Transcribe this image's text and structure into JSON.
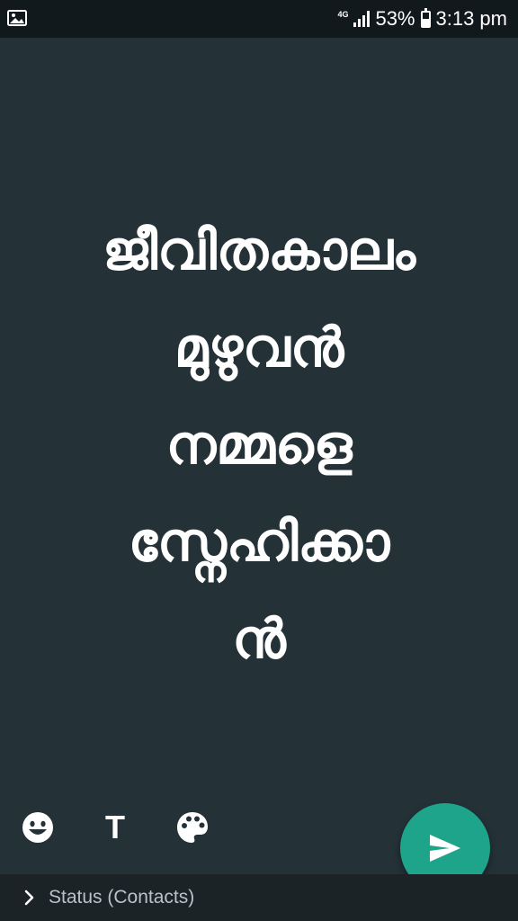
{
  "status_bar": {
    "network": "4G",
    "battery_percent": "53%",
    "battery_level": 0.53,
    "time": "3:13 pm",
    "notification_icon": "image-icon"
  },
  "message": {
    "lines": [
      "ജീവിതകാലം",
      "മുഴുവൻ",
      "നമ്മളെ",
      "സ്നേഹിക്കാ",
      "ൻ"
    ]
  },
  "toolbar": {
    "emoji_icon": "emoji-icon",
    "text_icon_label": "T",
    "palette_icon": "palette-icon"
  },
  "send": {
    "icon": "send-icon",
    "color": "#1ea48b"
  },
  "footer": {
    "audience_label": "Status (Contacts)"
  },
  "colors": {
    "background": "#243238",
    "status_bar": "#12191c",
    "footer": "#1b2327",
    "accent": "#1ea48b"
  }
}
